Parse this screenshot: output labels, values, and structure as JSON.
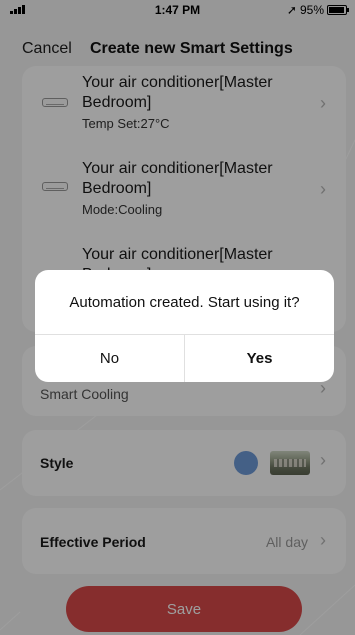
{
  "status_bar": {
    "time": "1:47 PM",
    "battery": "95%",
    "battery_level": 0.95,
    "location_icon": "location-arrow-icon"
  },
  "header": {
    "cancel_label": "Cancel",
    "title": "Create new Smart Settings"
  },
  "actions": [
    {
      "title": "Your air conditioner[Master Bedroom]",
      "subtitle": "Temp Set:27°C",
      "icon": "air-conditioner-icon"
    },
    {
      "title": "Your air conditioner[Master Bedroom]",
      "subtitle": "Mode:Cooling",
      "icon": "air-conditioner-icon"
    },
    {
      "title": "Your air conditioner[Master Bedroom]",
      "subtitle": "",
      "icon": "air-conditioner-icon"
    }
  ],
  "name_row": {
    "value": "Smart Cooling"
  },
  "style_row": {
    "label": "Style",
    "swatch_color": "#6f9bd9"
  },
  "period_row": {
    "label": "Effective Period",
    "value": "All day"
  },
  "save_label": "Save",
  "dialog": {
    "message": "Automation created. Start using it?",
    "no_label": "No",
    "yes_label": "Yes"
  },
  "colors": {
    "accent": "#d94a4a",
    "dim_overlay": "rgba(0,0,0,0.38)"
  }
}
